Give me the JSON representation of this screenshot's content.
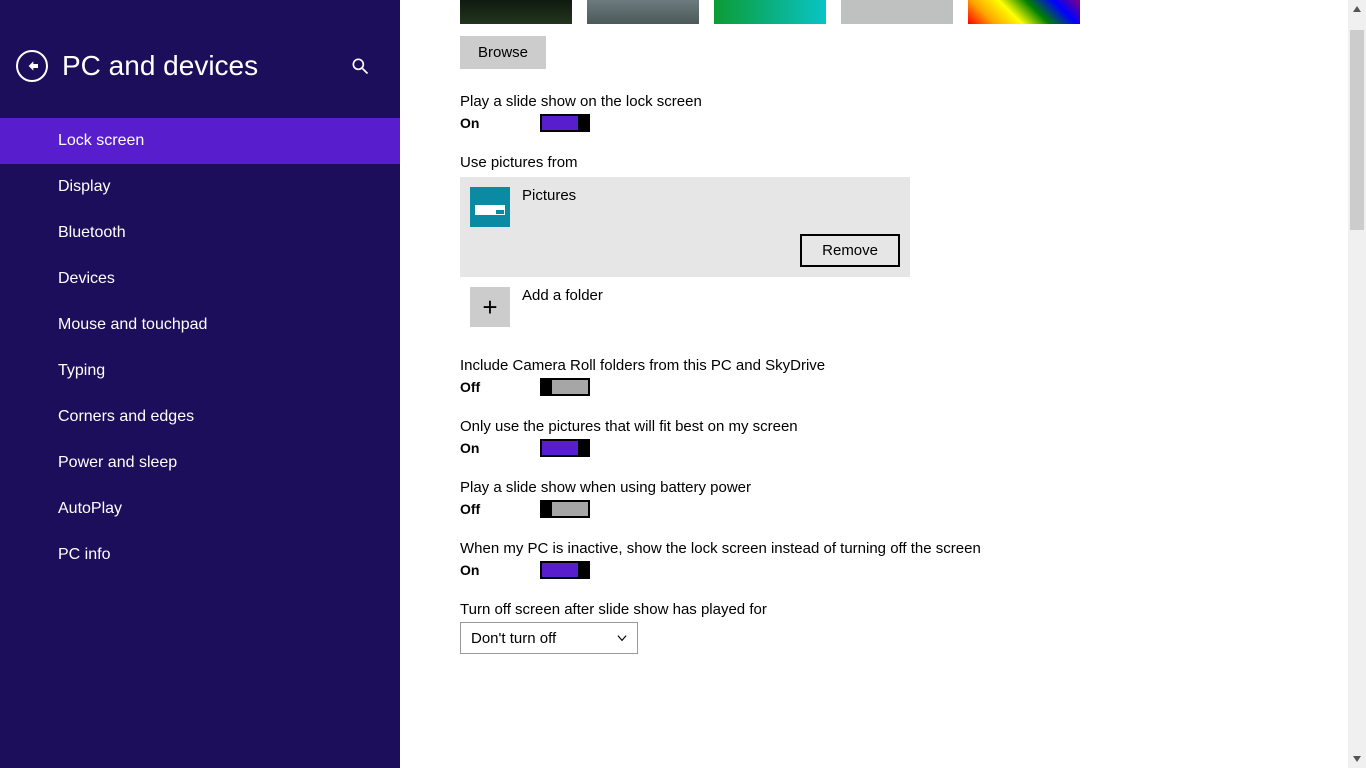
{
  "sidebar": {
    "title": "PC and devices",
    "items": [
      {
        "label": "Lock screen",
        "selected": true
      },
      {
        "label": "Display"
      },
      {
        "label": "Bluetooth"
      },
      {
        "label": "Devices"
      },
      {
        "label": "Mouse and touchpad"
      },
      {
        "label": "Typing"
      },
      {
        "label": "Corners and edges"
      },
      {
        "label": "Power and sleep"
      },
      {
        "label": "AutoPlay"
      },
      {
        "label": "PC info"
      }
    ]
  },
  "main": {
    "browse_label": "Browse",
    "slideshow": {
      "label": "Play a slide show on the lock screen",
      "state": "On"
    },
    "use_from_label": "Use pictures from",
    "folder_name": "Pictures",
    "remove_label": "Remove",
    "add_folder_label": "Add a folder",
    "camera_roll": {
      "label": "Include Camera Roll folders from this PC and SkyDrive",
      "state": "Off"
    },
    "fit_best": {
      "label": "Only use the pictures that will fit best on my screen",
      "state": "On"
    },
    "battery": {
      "label": "Play a slide show when using battery power",
      "state": "Off"
    },
    "inactive": {
      "label": "When my PC is inactive, show the lock screen instead of turning off the screen",
      "state": "On"
    },
    "turn_off_label": "Turn off screen after slide show has played for",
    "turn_off_value": "Don't turn off"
  }
}
